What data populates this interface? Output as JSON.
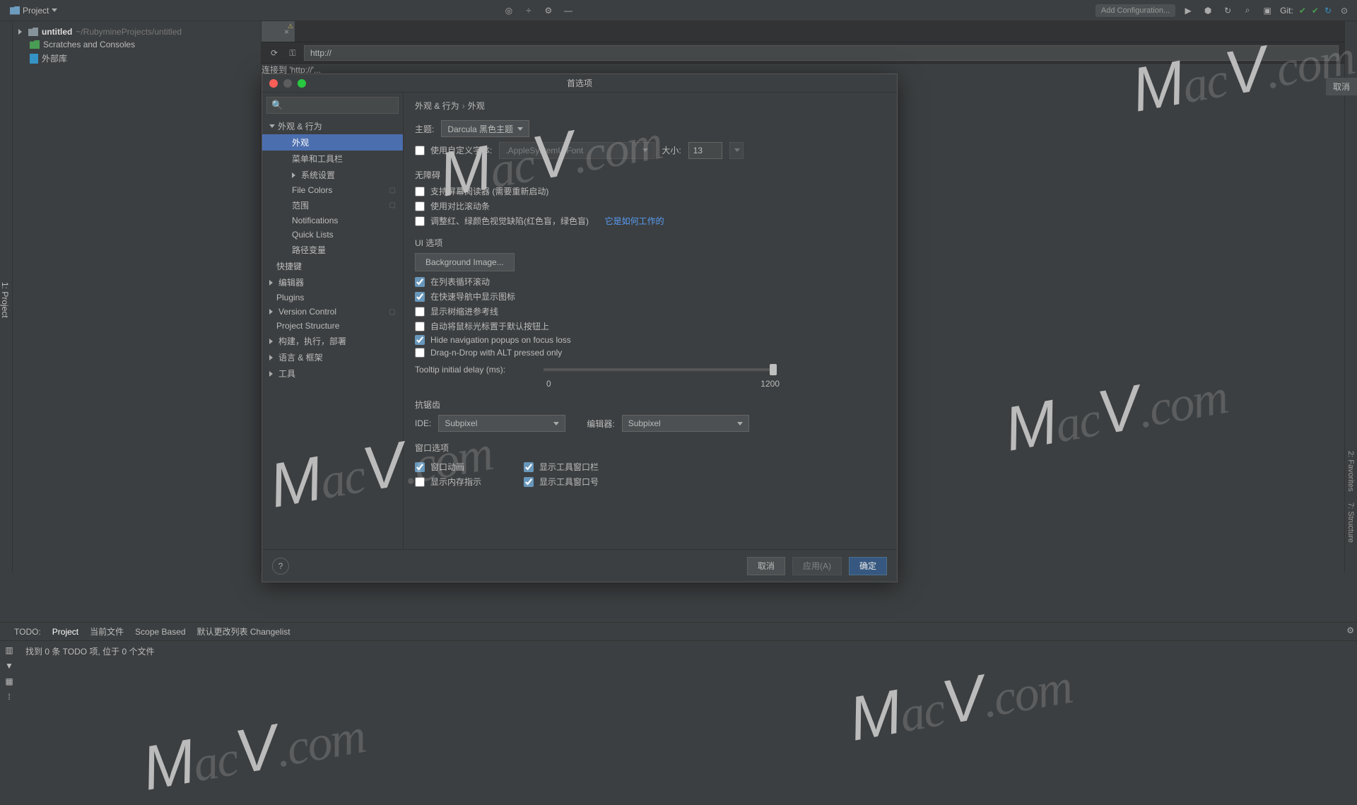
{
  "toolbar": {
    "project": "Project",
    "add_cfg": "Add Configuration...",
    "git": "Git:"
  },
  "tree": {
    "untitled": "untitled",
    "path": "~/RubymineProjects/untitled",
    "scratches": "Scratches and Consoles",
    "ext_lib": "外部库"
  },
  "left_tab": "1: Project",
  "right_tabs": {
    "fav": "2: Favorites",
    "struct": "7: Structure"
  },
  "url": {
    "value": "http://",
    "connecting": "连接到 'http://'..."
  },
  "cancel_top": "取消",
  "dialog": {
    "title": "首选项",
    "search_ph": "",
    "breadcrumb": {
      "a": "外观 & 行为",
      "b": "外观"
    },
    "categories": {
      "appearance_behavior": "外观 & 行为",
      "appearance": "外观",
      "menus": "菜单和工具栏",
      "system": "系统设置",
      "file_colors": "File Colors",
      "scopes": "范围",
      "notifications": "Notifications",
      "quick_lists": "Quick Lists",
      "path_vars": "路径变量",
      "keymap": "快捷键",
      "editor": "编辑器",
      "plugins": "Plugins",
      "vcs": "Version Control",
      "proj_struct": "Project Structure",
      "build": "构建，执行，部署",
      "lang": "语言 & 框架",
      "tools": "工具"
    },
    "theme_lbl": "主题:",
    "theme_val": "Darcula 黑色主题",
    "custom_font": "使用自定义字体:",
    "font_val": ".AppleSystemUIFont",
    "size_lbl": "大小:",
    "size_val": "13",
    "a11y": "无障碍",
    "screen_reader": "支持屏幕阅读器 (需要重新启动)",
    "contrast_scroll": "使用对比滚动条",
    "color_def": "调整红、绿颜色视觉缺陷(红色盲，绿色盲)",
    "how_link": "它是如何工作的",
    "ui_opts": "UI 选项",
    "bg_image": "Background Image...",
    "cyclic": "在列表循环滚动",
    "quick_nav_icons": "在快速导航中显示图标",
    "tree_indent": "显示树缩进参考线",
    "mouse_default": "自动将鼠标光标置于默认按钮上",
    "hide_popups": "Hide navigation popups on focus loss",
    "dnd_alt": "Drag-n-Drop with ALT pressed only",
    "tooltip_lbl": "Tooltip initial delay (ms):",
    "slider_min": "0",
    "slider_max": "1200",
    "antialias": "抗锯齿",
    "ide_lbl": "IDE:",
    "ide_val": "Subpixel",
    "editor_lbl": "编辑器:",
    "editor_val": "Subpixel",
    "win_opts": "窗口选项",
    "win_anim": "窗口动画",
    "show_mem": "显示内存指示",
    "show_tool_bar": "显示工具窗口栏",
    "show_tool_num": "显示工具窗口号",
    "cancel": "取消",
    "apply": "应用(A)",
    "ok": "确定"
  },
  "todo": {
    "label": "TODO:",
    "project": "Project",
    "current": "当前文件",
    "scope": "Scope Based",
    "changelist": "默认更改列表 Changelist",
    "msg": "找到 0 条 TODO 项, 位于 0 个文件"
  },
  "watermark": "MacV.com"
}
